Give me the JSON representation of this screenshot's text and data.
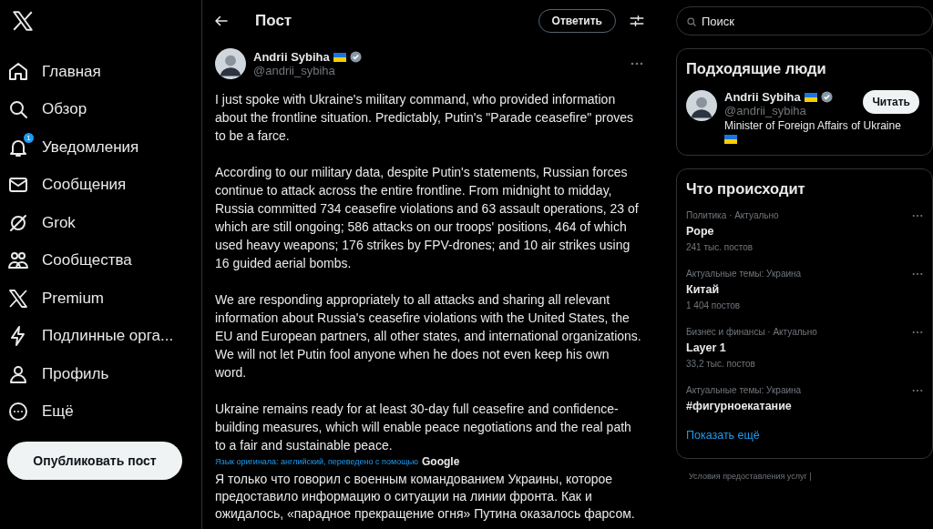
{
  "nav": {
    "items": [
      {
        "label": "Главная"
      },
      {
        "label": "Обзор"
      },
      {
        "label": "Уведомления",
        "badge": "1"
      },
      {
        "label": "Сообщения"
      },
      {
        "label": "Grok"
      },
      {
        "label": "Сообщества"
      },
      {
        "label": "Premium"
      },
      {
        "label": "Подлинные орга..."
      },
      {
        "label": "Профиль"
      },
      {
        "label": "Ещё"
      }
    ],
    "post_button": "Опубликовать пост"
  },
  "header": {
    "title": "Пост",
    "reply_button": "Ответить"
  },
  "post": {
    "author": "Andrii Sybiha",
    "handle": "@andrii_sybiha",
    "paragraphs": [
      "I just spoke with Ukraine's military command, who provided information about the frontline situation. Predictably, Putin's \"Parade ceasefire\" proves to be a farce.",
      "According to our military data, despite Putin's statements, Russian forces continue to attack across the entire frontline. From midnight to midday, Russia committed 734 ceasefire violations and 63 assault operations, 23 of which are still ongoing; 586 attacks on our troops' positions, 464 of which used heavy weapons; 176 strikes by FPV-drones; and 10 air strikes using 16 guided aerial bombs.",
      "We are responding appropriately to all attacks and sharing all relevant information about Russia's ceasefire violations with the United States, the EU and European partners, all other states, and international organizations. We will not let Putin fool anyone when he does not even keep his own word.",
      "Ukraine remains ready for at least 30-day full ceasefire and confidence-building measures, which will enable peace negotiations and the real path to a fair and sustainable peace."
    ],
    "translation_note": "Язык оригинала: английский, переведено с помощью",
    "translator": "Google",
    "translation": "Я только что говорил с военным командованием Украины, которое предоставило информацию о ситуации на линии фронта. Как и ожидалось, «парадное прекращение огня» Путина оказалось фарсом."
  },
  "search": {
    "placeholder": "Поиск"
  },
  "people": {
    "title": "Подходящие люди",
    "items": [
      {
        "name": "Andrii Sybiha",
        "handle": "@andrii_sybiha",
        "bio": "Minister of Foreign Affairs of Ukraine",
        "button": "Читать"
      }
    ]
  },
  "trends": {
    "title": "Что происходит",
    "items": [
      {
        "context": "Политика · Актуально",
        "topic": "Pope",
        "count": "241 тыс. постов"
      },
      {
        "context": "Актуальные темы: Украина",
        "topic": "Китай",
        "count": "1 404 постов"
      },
      {
        "context": "Бизнес и финансы · Актуально",
        "topic": "Layer 1",
        "count": "33,2 тыс. постов"
      },
      {
        "context": "Актуальные темы: Украина",
        "topic": "#фигурноекатание"
      }
    ],
    "show_more": "Показать ещё"
  },
  "footer": {
    "links": [
      "Условия предоставления услуг |"
    ]
  }
}
